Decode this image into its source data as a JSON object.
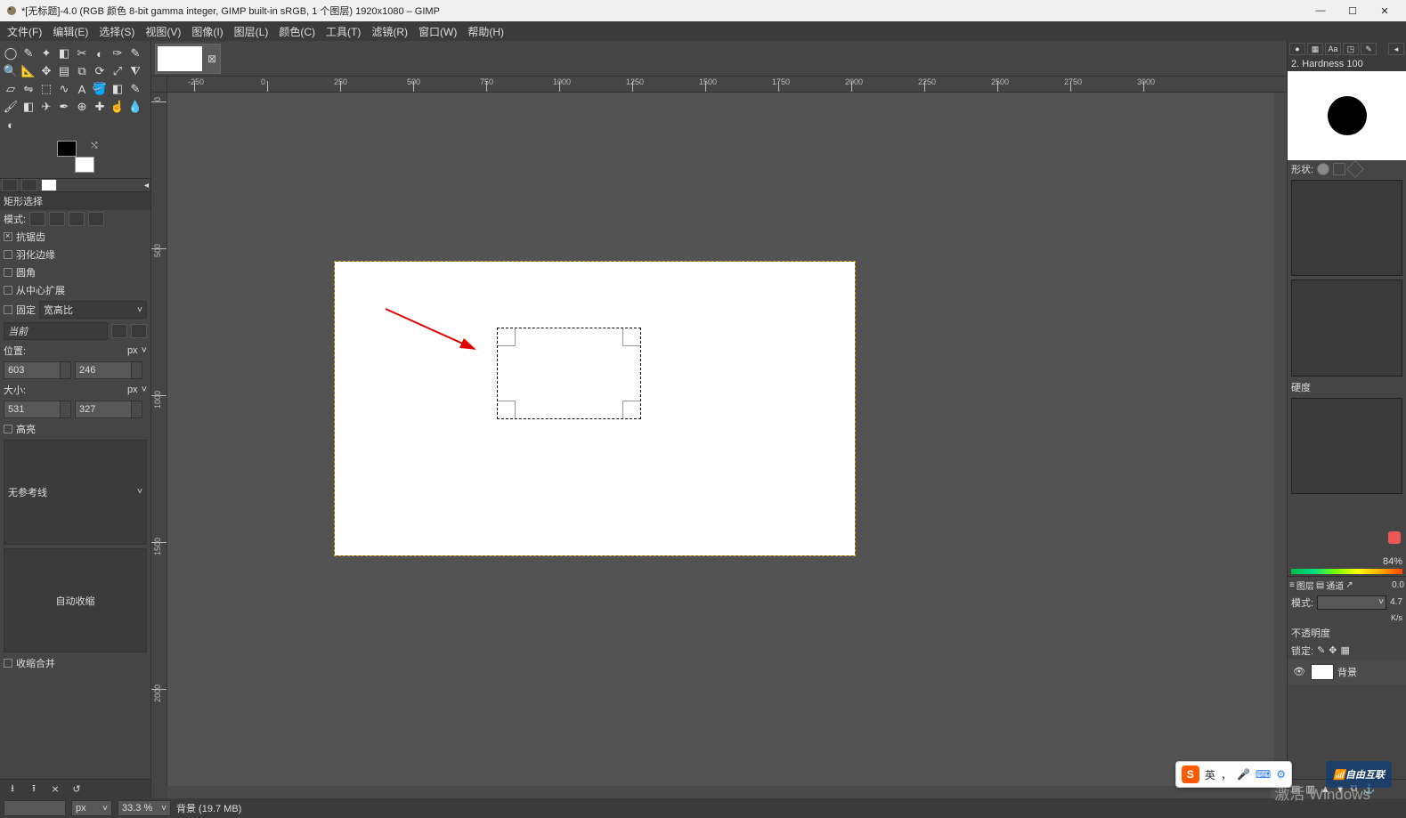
{
  "window": {
    "title": "*[无标题]-4.0 (RGB 颜色 8-bit gamma integer, GIMP built-in sRGB, 1 个图层) 1920x1080 – GIMP"
  },
  "menu": {
    "file": "文件(F)",
    "edit": "编辑(E)",
    "select": "选择(S)",
    "view": "视图(V)",
    "image": "图像(I)",
    "layer": "图层(L)",
    "color": "颜色(C)",
    "tools": "工具(T)",
    "filters": "滤镜(R)",
    "window": "窗口(W)",
    "help": "帮助(H)"
  },
  "tool_options": {
    "title": "矩形选择",
    "mode_label": "模式:",
    "antialias": "抗锯齿",
    "feather": "羽化边缘",
    "rounded": "圆角",
    "from_center": "从中心扩展",
    "fixed": "固定",
    "aspect": "宽高比",
    "current": "当前",
    "position": "位置:",
    "px": "px",
    "pos_x": "603",
    "pos_y": "246",
    "size_label": "大小:",
    "size_w": "531",
    "size_h": "327",
    "highlight": "高亮",
    "guides": "无参考线",
    "auto_shrink": "自动收缩",
    "shrink_merged": "收缩合并"
  },
  "ruler": {
    "h": [
      "-250",
      "0",
      "250",
      "500",
      "750",
      "1000",
      "1250",
      "1500",
      "1750",
      "2000",
      "2250",
      "2500",
      "2750",
      "3000"
    ],
    "v": [
      "0",
      "500",
      "1000",
      "1500",
      "2000"
    ]
  },
  "right": {
    "brush_title": "2. Hardness 100",
    "shape_label": "形状:",
    "hardness_label": "硬度",
    "percent": "84%",
    "layers_tab": "图层",
    "channels_tab": "通道",
    "mode_label": "模式:",
    "opacity_label": "不透明度",
    "lock_label": "锁定:",
    "layer_name": "背景",
    "kbs1": "K/s",
    "kbs2": "K/s",
    "num": "0.0",
    "num2": "4.7"
  },
  "status": {
    "unit": "px",
    "zoom": "33.3 %",
    "info": "背景 (19.7 MB)",
    "activate": "激活 Windows"
  },
  "ime": {
    "lang": "英",
    "punct": "，",
    "icon1": "🎤",
    "icon2": "⌨",
    "icon3": "⚙"
  },
  "watermark": "自由互联"
}
